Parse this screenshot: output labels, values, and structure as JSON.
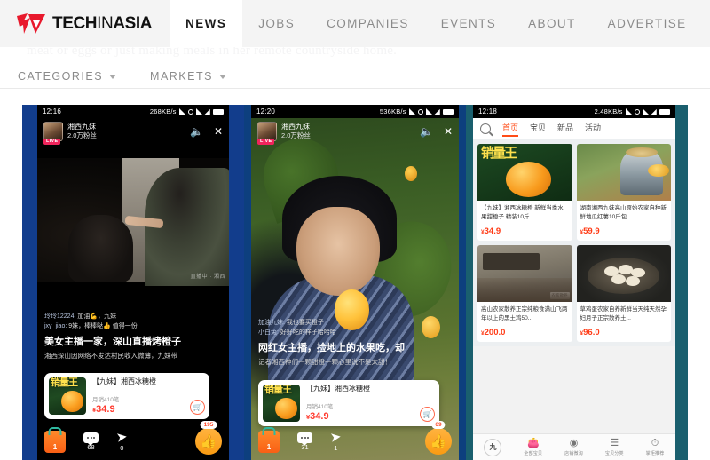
{
  "site": {
    "logo_text_1": "TECH",
    "logo_text_2": "IN",
    "logo_text_3": "ASIA",
    "ghost_article_text": "meat or eggs or just making meals in her remote countryside home."
  },
  "nav": {
    "items": [
      {
        "label": "NEWS",
        "active": true
      },
      {
        "label": "JOBS",
        "active": false
      },
      {
        "label": "COMPANIES",
        "active": false
      },
      {
        "label": "EVENTS",
        "active": false
      },
      {
        "label": "ABOUT",
        "active": false
      },
      {
        "label": "ADVERTISE",
        "active": false
      }
    ]
  },
  "subnav": {
    "items": [
      {
        "label": "CATEGORIES"
      },
      {
        "label": "MARKETS"
      }
    ]
  },
  "figure": {
    "phone1": {
      "status": {
        "time": "12:16",
        "speed": "268KB/s"
      },
      "streamer": {
        "name": "湘西九妹",
        "fans": "2.0万粉丝",
        "live_badge": "LIVE"
      },
      "chat": [
        {
          "user": "玲玲12224:",
          "text": "加油💪，九妹"
        },
        {
          "user": "jxy_jiao:",
          "text": "9妹，棒棒哒👍 值得一份"
        }
      ],
      "title": "美女主播一家，深山直播烤橙子",
      "subtitle": "湘西深山因网络不发达村民收入微薄，九妹带",
      "watermark": "直播中 · 湘西",
      "product": {
        "name": "【九妹】湘西冰糖橙",
        "sales": "月销410笔",
        "currency": "¥",
        "price": "34.9",
        "thumb_text": "销量王"
      },
      "actions": {
        "bag_count": "1",
        "comments": "68",
        "shares": "0",
        "like_badge": "195"
      }
    },
    "phone2": {
      "status": {
        "time": "12:20",
        "speed": "536KB/s"
      },
      "streamer": {
        "name": "湘西九妹",
        "fans": "2.0万粉丝",
        "live_badge": "LIVE"
      },
      "chat": [
        {
          "user": "加油九妹:",
          "text": "我也要买橙子"
        },
        {
          "user": "小白兔:",
          "text": "好好吃的样子哈哈哈"
        }
      ],
      "title": "网红女主播，捡地上的水果吃，却",
      "subtitle": "记者湘西神们一颗甜橙一颗心里说不是太甜！",
      "product": {
        "name": "【九妹】湘西冰糖橙",
        "sales": "月销410笔",
        "currency": "¥",
        "price": "34.9",
        "thumb_text": "销量王"
      },
      "actions": {
        "bag_count": "1",
        "comments": "31",
        "shares": "1",
        "like_badge": "69"
      }
    },
    "phone3": {
      "status": {
        "time": "12:18",
        "speed": "2.48KB/s"
      },
      "tabs": [
        {
          "label": "首页",
          "active": true
        },
        {
          "label": "宝贝",
          "active": false
        },
        {
          "label": "新品",
          "active": false
        },
        {
          "label": "活动",
          "active": false
        }
      ],
      "products": [
        {
          "name": "【九妹】湘西冰糖橙 新鲜当季水果甜橙子 精装10斤...",
          "currency": "¥",
          "price": "34.9",
          "thumb_text": "销量王",
          "image": "orange"
        },
        {
          "name": "湖南湘西九妹高山原始农家自种新鲜地瓜红薯10斤包...",
          "currency": "¥",
          "price": "59.9",
          "thumb_text": "",
          "image": "potato"
        },
        {
          "name": "高山农家散养正宗纯粮食满山飞两年以上的黑土鸡50...",
          "currency": "¥",
          "price": "200.0",
          "thumb_text": "",
          "badge": "农家散养",
          "image": "chicken"
        },
        {
          "name": "草鸡蛋农家自养新鲜当天纯天然孕妇月子正宗散养土...",
          "currency": "¥",
          "price": "96.0",
          "thumb_text": "",
          "image": "eggs"
        }
      ],
      "bottom_nav": [
        {
          "label": "",
          "icon": "shop-logo-icon"
        },
        {
          "label": "全部宝贝",
          "icon": "bag-icon"
        },
        {
          "label": "店铺微淘",
          "icon": "broadcast-icon"
        },
        {
          "label": "宝贝分类",
          "icon": "list-icon"
        },
        {
          "label": "掌柜推荐",
          "icon": "clock-icon"
        }
      ]
    }
  },
  "colors": {
    "brand_red": "#e8192c",
    "panel1_bg": "#123d8c",
    "panel2_bg": "#0d3f7e",
    "panel3_bg": "#1a5f6e",
    "price_red": "#ff3b2f",
    "tab_orange": "#ff4d18"
  }
}
